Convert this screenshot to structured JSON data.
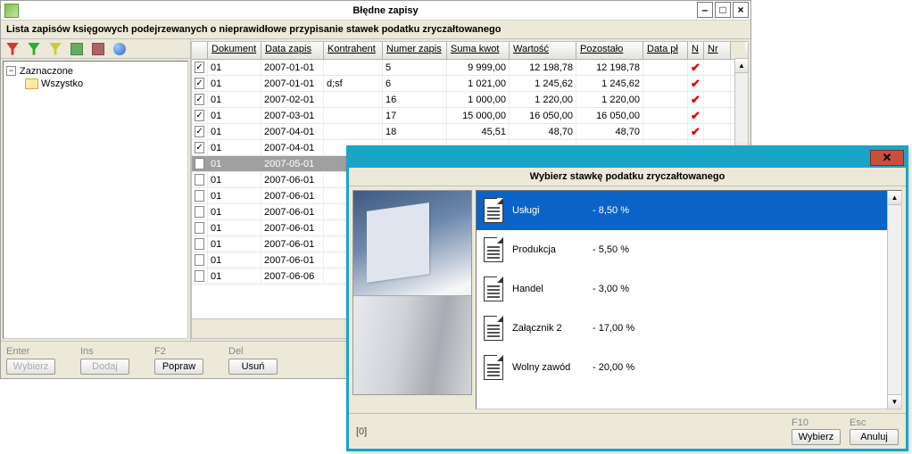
{
  "win1": {
    "title": "Błędne zapisy",
    "description": "Lista zapisów księgowych podejrzewanych o nieprawidłowe przypisanie stawek podatku zryczałtowanego",
    "tree": {
      "root": "Zaznaczone",
      "child": "Wszystko"
    },
    "columns": [
      "",
      "Dokument",
      "Data zapis",
      "Kontrahent",
      "Numer zapis",
      "Suma kwot",
      "Wartość",
      "Pozostało",
      "Data pł",
      "N",
      "Nr"
    ],
    "rows": [
      {
        "chk": true,
        "doc": "01",
        "date": "2007-01-01",
        "kontr": "",
        "nr": "5",
        "suma": "9 999,00",
        "wart": "12 198,78",
        "poz": "12 198,78",
        "n": true
      },
      {
        "chk": true,
        "doc": "01",
        "date": "2007-01-01",
        "kontr": "d;sf",
        "nr": "6",
        "suma": "1 021,00",
        "wart": "1 245,62",
        "poz": "1 245,62",
        "n": true
      },
      {
        "chk": true,
        "doc": "01",
        "date": "2007-02-01",
        "kontr": "",
        "nr": "16",
        "suma": "1 000,00",
        "wart": "1 220,00",
        "poz": "1 220,00",
        "n": true
      },
      {
        "chk": true,
        "doc": "01",
        "date": "2007-03-01",
        "kontr": "",
        "nr": "17",
        "suma": "15 000,00",
        "wart": "16 050,00",
        "poz": "16 050,00",
        "n": true
      },
      {
        "chk": true,
        "doc": "01",
        "date": "2007-04-01",
        "kontr": "",
        "nr": "18",
        "suma": "45,51",
        "wart": "48,70",
        "poz": "48,70",
        "n": true
      },
      {
        "chk": true,
        "doc": "01",
        "date": "2007-04-01",
        "kontr": "",
        "nr": "",
        "suma": "",
        "wart": "",
        "poz": "",
        "n": false
      },
      {
        "chk": false,
        "doc": "01",
        "date": "2007-05-01",
        "kontr": "",
        "nr": "",
        "suma": "",
        "wart": "",
        "poz": "",
        "n": false,
        "selected": true
      },
      {
        "chk": false,
        "doc": "01",
        "date": "2007-06-01",
        "kontr": "",
        "nr": "",
        "suma": "",
        "wart": "",
        "poz": "",
        "n": false
      },
      {
        "chk": false,
        "doc": "01",
        "date": "2007-06-01",
        "kontr": "",
        "nr": "",
        "suma": "",
        "wart": "",
        "poz": "",
        "n": false
      },
      {
        "chk": false,
        "doc": "01",
        "date": "2007-06-01",
        "kontr": "",
        "nr": "",
        "suma": "",
        "wart": "",
        "poz": "",
        "n": false
      },
      {
        "chk": false,
        "doc": "01",
        "date": "2007-06-01",
        "kontr": "",
        "nr": "",
        "suma": "",
        "wart": "",
        "poz": "",
        "n": false
      },
      {
        "chk": false,
        "doc": "01",
        "date": "2007-06-01",
        "kontr": "",
        "nr": "",
        "suma": "",
        "wart": "",
        "poz": "",
        "n": false
      },
      {
        "chk": false,
        "doc": "01",
        "date": "2007-06-01",
        "kontr": "",
        "nr": "",
        "suma": "",
        "wart": "",
        "poz": "",
        "n": false
      },
      {
        "chk": false,
        "doc": "01",
        "date": "2007-06-06",
        "kontr": "",
        "nr": "",
        "suma": "",
        "wart": "",
        "poz": "",
        "n": false
      }
    ],
    "footer": {
      "enter": {
        "key": "Enter",
        "label": "Wybierz",
        "disabled": true
      },
      "ins": {
        "key": "Ins",
        "label": "Dodaj",
        "disabled": true
      },
      "f2": {
        "key": "F2",
        "label": "Popraw",
        "disabled": false
      },
      "del": {
        "key": "Del",
        "label": "Usuń",
        "disabled": false
      }
    }
  },
  "win2": {
    "title": "Wybierz stawkę podatku zryczałtowanego",
    "items": [
      {
        "label": "Usługi",
        "rate": "8,50 %",
        "selected": true
      },
      {
        "label": "Produkcja",
        "rate": "5,50 %"
      },
      {
        "label": "Handel",
        "rate": "3,00 %"
      },
      {
        "label": "Załącznik 2",
        "rate": "17,00 %"
      },
      {
        "label": "Wolny zawód",
        "rate": "20,00 %"
      }
    ],
    "counter": "[0]",
    "footer": {
      "f10": {
        "key": "F10",
        "label": "Wybierz"
      },
      "esc": {
        "key": "Esc",
        "label": "Anuluj"
      }
    }
  }
}
